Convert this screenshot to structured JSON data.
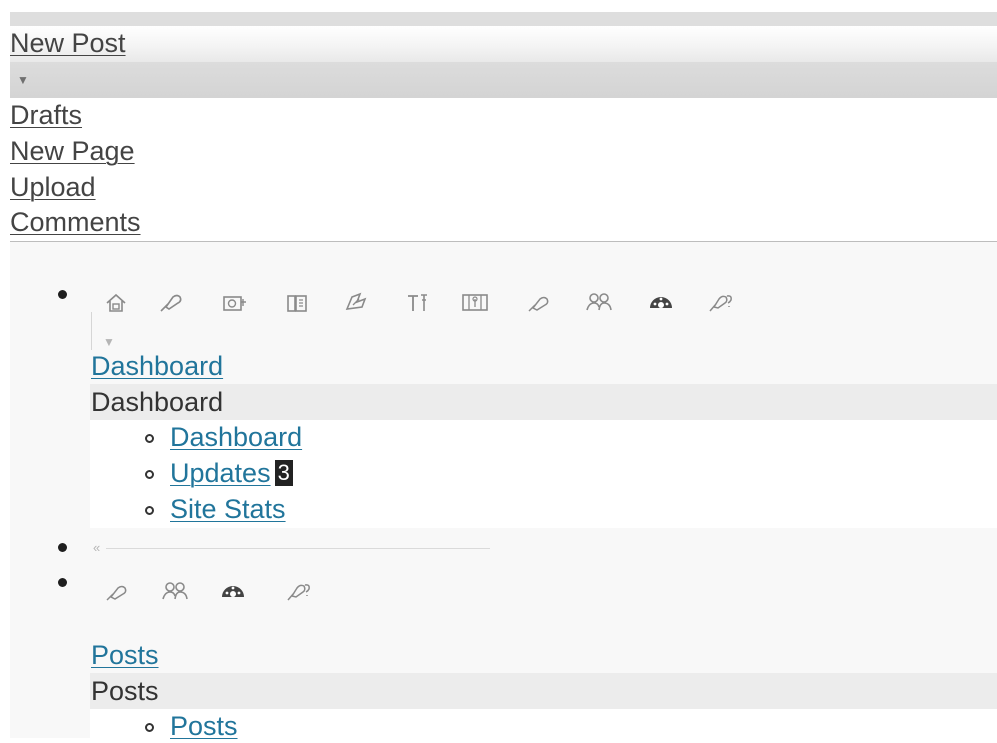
{
  "favorites": {
    "first": "New Post",
    "toggle_arrow": "▼",
    "items": [
      "Drafts",
      "New Page",
      "Upload",
      "Comments"
    ]
  },
  "menu": {
    "icon_names": [
      "home-icon",
      "posts-pin-icon",
      "media-icon",
      "links-icon",
      "pages-icon",
      "tools-icon",
      "appearance-icon",
      "plugins-icon",
      "users-icon",
      "dashboard-gauge-icon",
      "settings-icon"
    ],
    "small_arrow": "▼",
    "dashboard": {
      "link": "Dashboard",
      "heading": "Dashboard",
      "sub": [
        {
          "label": "Dashboard"
        },
        {
          "label": "Updates",
          "count": "3"
        },
        {
          "label": "Site Stats"
        }
      ]
    },
    "collapse": "«",
    "posts_icon_names": [
      "plugins-icon",
      "users-icon",
      "dashboard-gauge-icon",
      "settings-icon"
    ],
    "posts": {
      "link": "Posts",
      "heading": "Posts",
      "sub": [
        {
          "label": "Posts"
        }
      ]
    }
  }
}
